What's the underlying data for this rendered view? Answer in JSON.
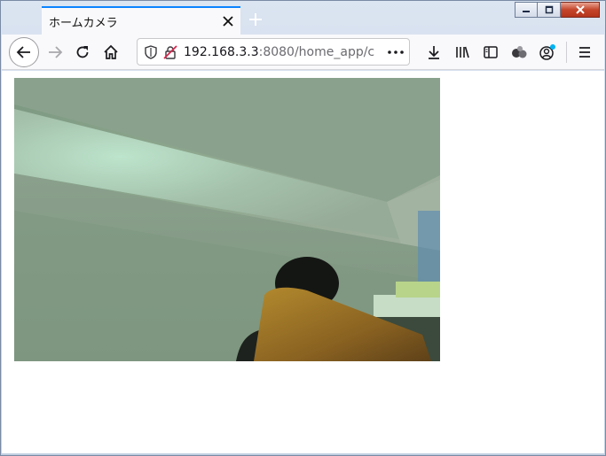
{
  "browser": {
    "tab": {
      "title": "ホームカメラ"
    },
    "address": {
      "host": "192.168.3.3",
      "rest": ":8080/home_app/c"
    }
  },
  "page": {
    "camera_feed": {
      "description": "live camera image"
    }
  },
  "colors": {
    "accent": "#0a84ff",
    "close_button": "#c4452b"
  },
  "icons": [
    "back-icon",
    "forward-icon",
    "reload-icon",
    "home-icon",
    "shield-icon",
    "insecure-lock-icon",
    "more-icon",
    "download-icon",
    "library-icon",
    "sidebar-icon",
    "extensions-icon",
    "account-icon",
    "menu-icon",
    "tab-close-icon",
    "new-tab-icon"
  ]
}
